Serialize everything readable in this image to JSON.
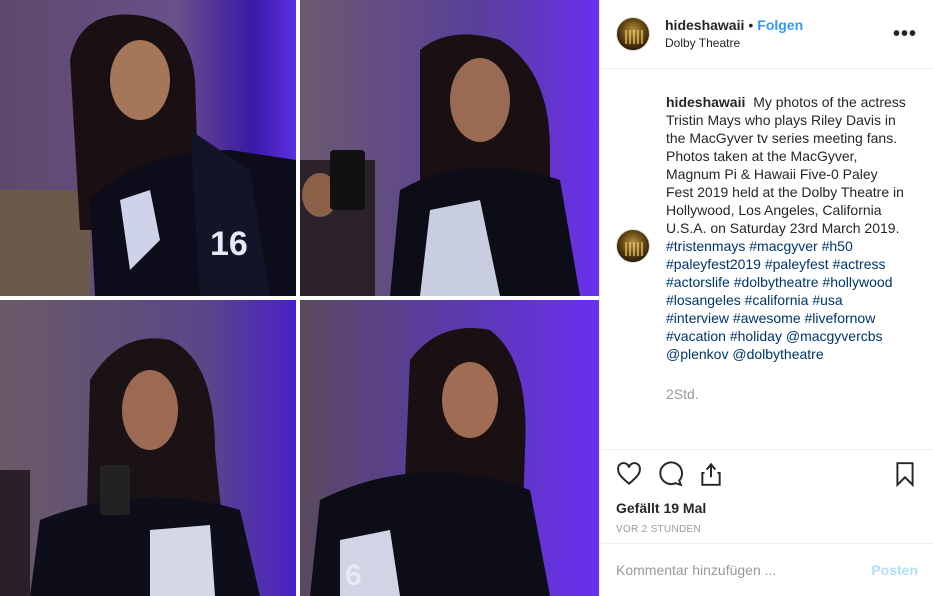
{
  "post": {
    "username": "hideshawaii",
    "follow_label": "Folgen",
    "separator": "•",
    "location": "Dolby Theatre",
    "more_icon": "•••"
  },
  "caption": {
    "username": "hideshawaii",
    "text": "My photos of the actress Tristin Mays who plays Riley Davis in the MacGyver tv series meeting fans. Photos taken at the MacGyver, Magnum Pi & Hawaii Five-0 Paley Fest 2019 held at the Dolby Theatre in Hollywood, Los Angeles, California U.S.A. on Saturday 23rd March 2019.",
    "hashtags": "#tristenmays #macgyver #h50 #paleyfest2019 #paleyfest #actress #actorslife #dolbytheatre #hollywood #losangeles #california #usa #interview #awesome #livefornow #vacation #holiday @macgyvercbs @plenkov @dolbytheatre",
    "time": "2Std."
  },
  "actions": {
    "icons": [
      "heart-icon",
      "comment-icon",
      "share-icon",
      "bookmark-icon"
    ],
    "likes": "Gefällt 19 Mal",
    "ago": "VOR 2 STUNDEN"
  },
  "comment_box": {
    "placeholder": "Kommentar hinzufügen ...",
    "post_label": "Posten"
  },
  "colors": {
    "accent": "#3897f0",
    "hashtag": "#003569",
    "muted": "#999999",
    "post_disabled": "#b2dffc"
  }
}
